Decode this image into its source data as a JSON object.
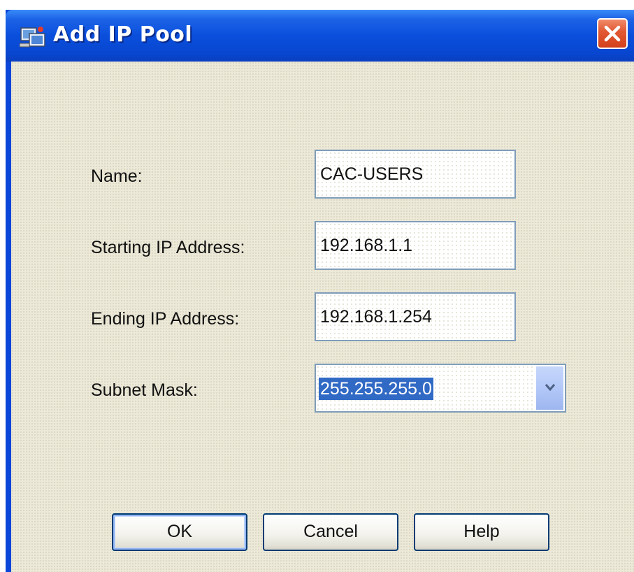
{
  "window": {
    "title": "Add IP Pool",
    "title_icon": "network-icon",
    "close_icon": "close-icon"
  },
  "form": {
    "name": {
      "label": "Name:",
      "value": "CAC-USERS"
    },
    "start_ip": {
      "label": "Starting IP Address:",
      "value": "192.168.1.1"
    },
    "end_ip": {
      "label": "Ending IP Address:",
      "value": "192.168.1.254"
    },
    "subnet_mask": {
      "label": "Subnet Mask:",
      "value": "255.255.255.0",
      "selected": true,
      "dropdown_icon": "chevron-down-icon"
    }
  },
  "buttons": {
    "ok": "OK",
    "cancel": "Cancel",
    "help": "Help"
  },
  "colors": {
    "title_bar": "#0a46d8",
    "dialog_bg": "#ece9d8",
    "close_button": "#d2401b",
    "selection": "#316ac5",
    "field_border": "#7f9db9"
  }
}
